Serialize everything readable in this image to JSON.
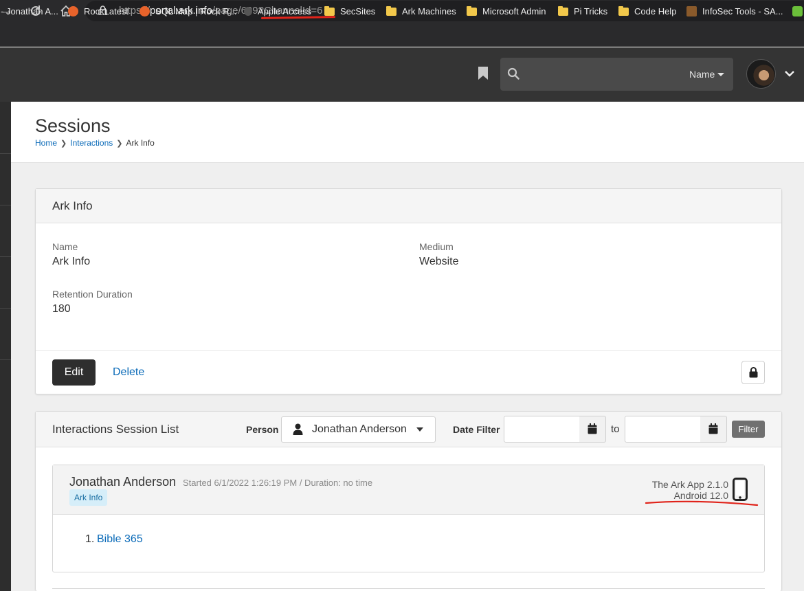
{
  "browser": {
    "url_prefix": "https://",
    "url_host": "portal.ark.info",
    "url_path": "/page/699?ChannelId=6",
    "bookmarks": [
      "- Jonathan A...",
      "RockLatest",
      "SQL Map | Rock R...",
      "Apple Access",
      "SecSites",
      "Ark Machines",
      "Microsoft Admin",
      "Pi Tricks",
      "Code Help",
      "InfoSec Tools - SA..."
    ]
  },
  "header": {
    "search_filter_label": "Name"
  },
  "page": {
    "title": "Sessions",
    "breadcrumb": [
      "Home",
      "Interactions",
      "Ark Info"
    ]
  },
  "channel_panel": {
    "title": "Ark Info",
    "fields": {
      "name_label": "Name",
      "name_value": "Ark Info",
      "medium_label": "Medium",
      "medium_value": "Website",
      "retention_label": "Retention Duration",
      "retention_value": "180"
    },
    "edit_label": "Edit",
    "delete_label": "Delete"
  },
  "session_list": {
    "title": "Interactions Session List",
    "person_label": "Person",
    "person_value": "Jonathan Anderson",
    "date_filter_label": "Date Filter",
    "to_label": "to",
    "filter_button": "Filter",
    "sessions": [
      {
        "person": "Jonathan Anderson",
        "meta": "Started 6/1/2022 1:26:19 PM / Duration: no time",
        "badge": "Ark Info",
        "device_app": "The Ark App 2.1.0",
        "device_os": "Android 12.0",
        "items": [
          {
            "num": "1.",
            "label": "Bible 365"
          }
        ]
      }
    ]
  },
  "colors": {
    "link": "#0a6ab8",
    "header_bg": "#343434",
    "annotation_red": "#e0231a",
    "badge_bg": "#d6eef9"
  }
}
